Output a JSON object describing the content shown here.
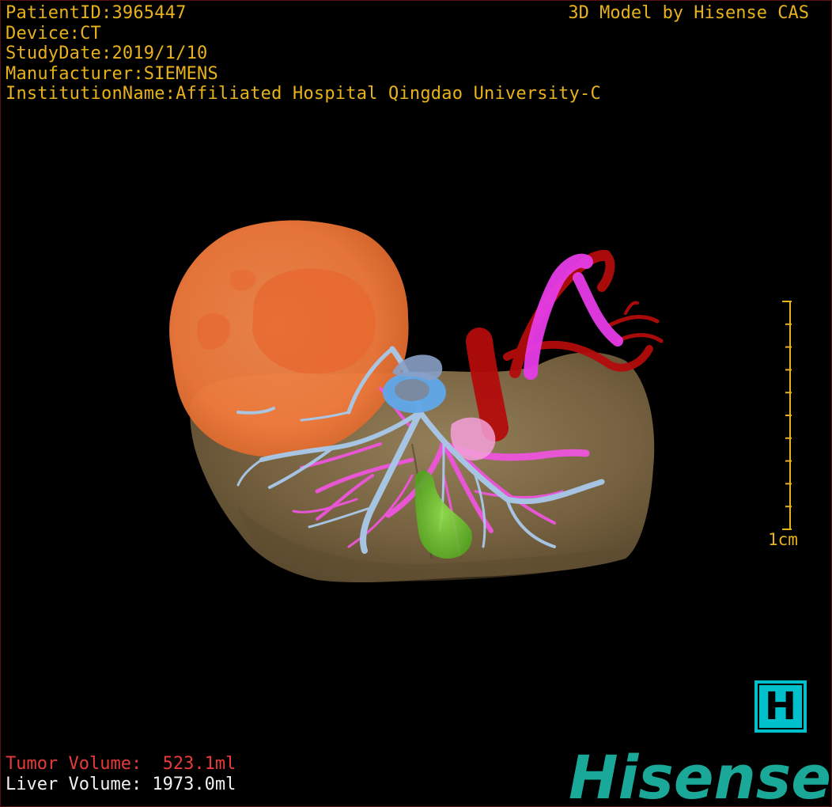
{
  "patient_info": {
    "patient_id": "PatientID:3965447",
    "device": "Device:CT",
    "study_date": "StudyDate:2019/1/10",
    "manufacturer": "Manufacturer:SIEMENS",
    "institution": "InstitutionName:Affiliated Hospital Qingdao University-C"
  },
  "brand_label": "3D Model by Hisense CAS",
  "scale": {
    "label": "1cm",
    "ticks": 11
  },
  "h_button_label": "H",
  "logo_text": "Hisense",
  "volumes": {
    "tumor": "Tumor Volume:  523.1ml",
    "liver": "Liver Volume: 1973.0ml"
  },
  "colors": {
    "info_text": "#e8b21a",
    "tumor": "#f07a3c",
    "liver": "#7a6440",
    "artery": "#b30c0c",
    "portal_vein": "#ee55dd",
    "hepatic_vein": "#a8c8e8",
    "gallbladder": "#6ec82a",
    "logo": "#1aa898",
    "tumor_volume_text": "#e83a3a",
    "liver_volume_text": "#f2f2f2"
  }
}
